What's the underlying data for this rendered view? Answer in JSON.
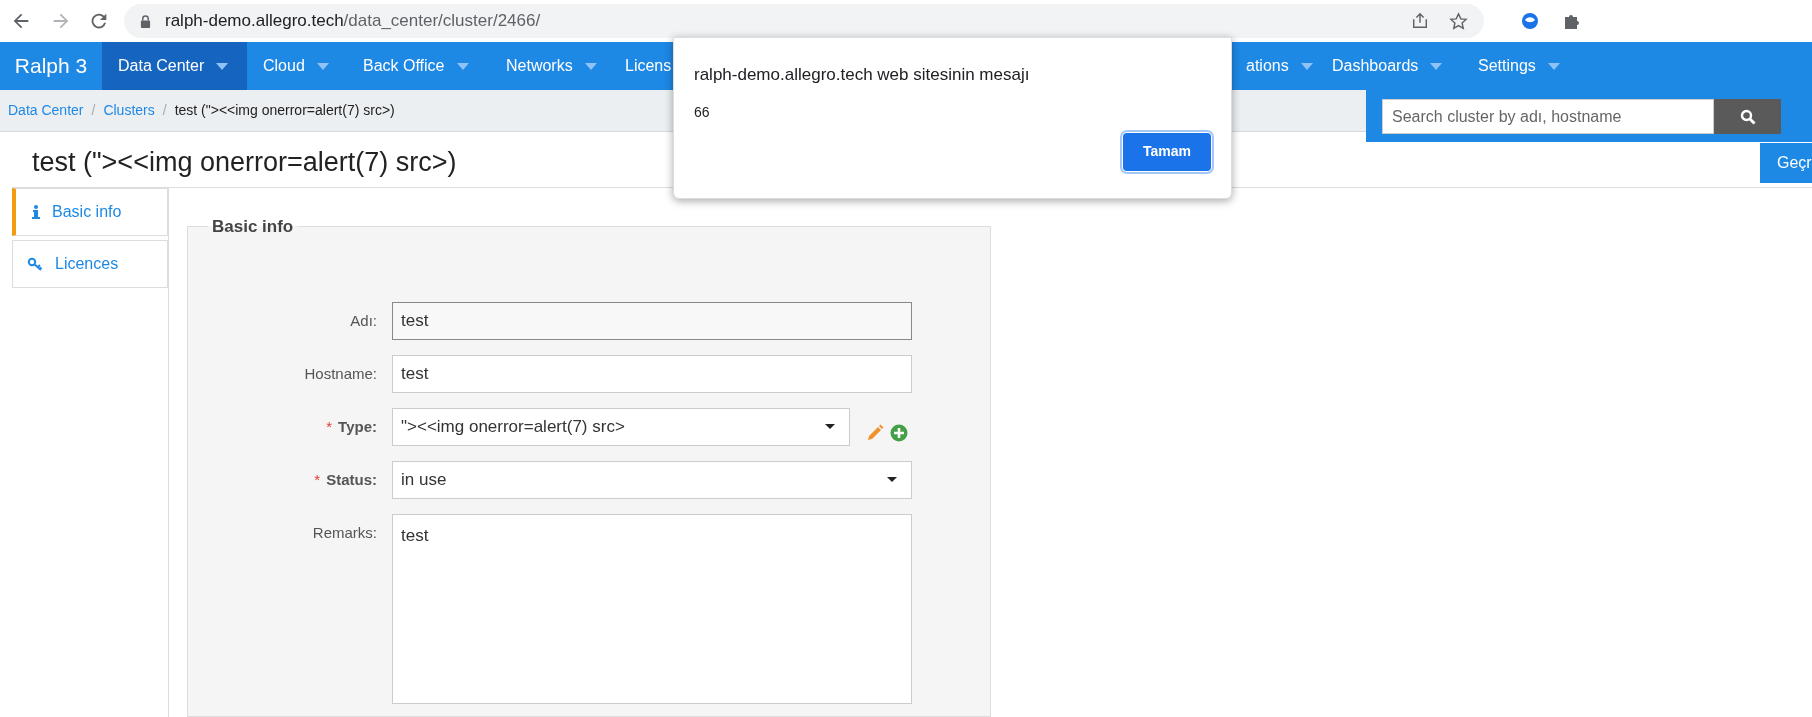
{
  "browser": {
    "url_host": "ralph-demo.allegro.tech",
    "url_path": "/data_center/cluster/2466/"
  },
  "nav": {
    "logo": "Ralph 3",
    "items": [
      {
        "label": "Data Center",
        "selected": true
      },
      {
        "label": "Cloud",
        "selected": false
      },
      {
        "label": "Back Office",
        "selected": false
      },
      {
        "label": "Networks",
        "selected": false
      },
      {
        "label": "Licens",
        "selected": false
      },
      {
        "label": "ations",
        "selected": false
      },
      {
        "label": "Dashboards",
        "selected": false
      },
      {
        "label": "Settings",
        "selected": false
      }
    ]
  },
  "breadcrumb_separator": "/",
  "required_mark": "*",
  "breadcrumbs": [
    "Data Center",
    "Clusters",
    "test (\"><<img onerror=alert(7) src>)"
  ],
  "search": {
    "placeholder": "Search cluster by adı, hostname"
  },
  "page_title": "test (\"><<img onerror=alert(7) src>)",
  "action_button": "Geçr",
  "side_tabs": [
    {
      "label": "Basic info",
      "kind": "info",
      "selected": true
    },
    {
      "label": "Licences",
      "kind": "key",
      "selected": false
    }
  ],
  "fieldset": {
    "legend": "Basic info",
    "fields": [
      {
        "label": "Adı:",
        "kind": "text",
        "value": "test",
        "required": false,
        "focused": true
      },
      {
        "label": "Hostname:",
        "kind": "text",
        "value": "test",
        "required": false,
        "focused": false
      },
      {
        "label": "Type:",
        "kind": "select",
        "value": "\"><<img onerror=alert(7) src>",
        "required": true,
        "focused": false,
        "actions": true
      },
      {
        "label": "Status:",
        "kind": "select",
        "value": "in use",
        "required": true,
        "focused": false
      },
      {
        "label": "Remarks:",
        "kind": "textarea",
        "value": "test",
        "required": false,
        "focused": false
      }
    ]
  },
  "dialog": {
    "title": "ralph-demo.allegro.tech web sitesinin mesajı",
    "message": "66",
    "button": "Tamam"
  }
}
